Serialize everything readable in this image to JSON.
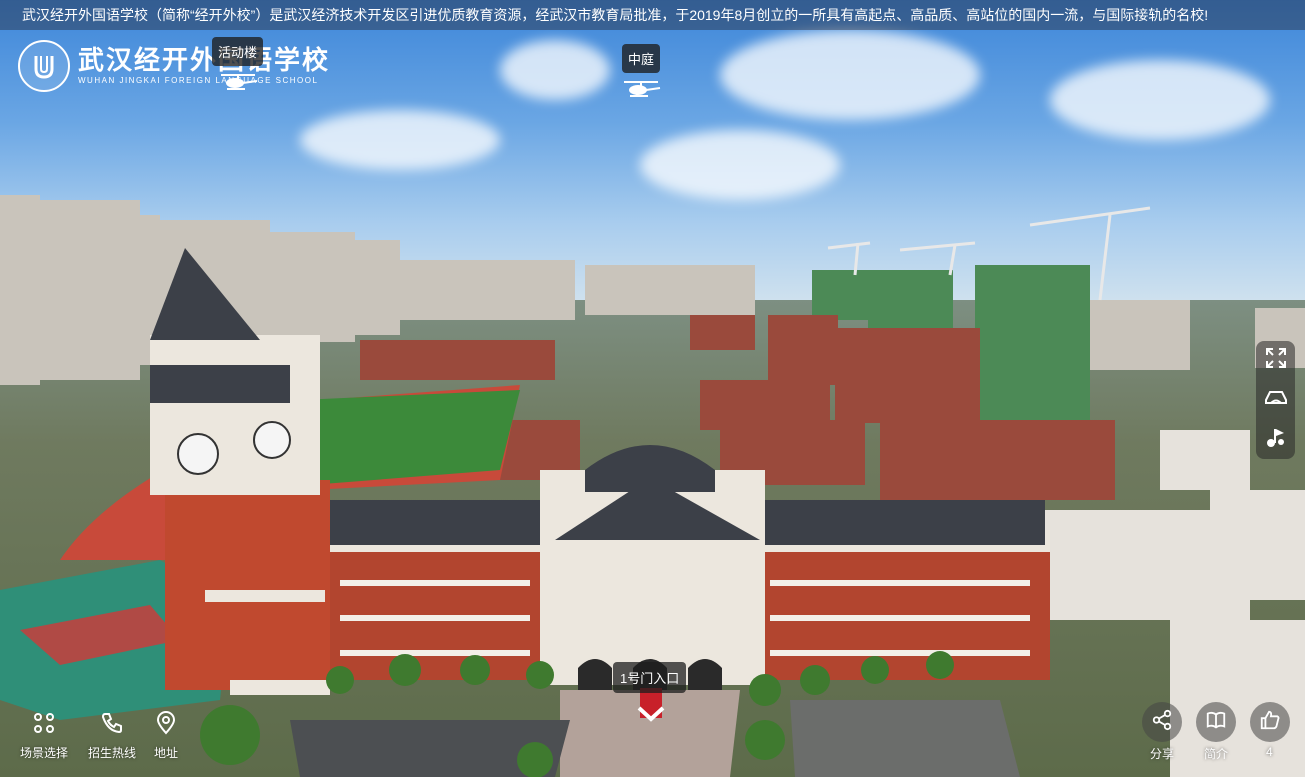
{
  "ticker": {
    "text": "武汉经开外国语学校（简称“经开外校”）是武汉经济技术开发区引进优质教育资源，经武汉市教育局批准，于2019年8月创立的一所具有高起点、高品质、高站位的国内一流，与国际接轨的名校!"
  },
  "logo": {
    "cn": "武汉经开外国语学校",
    "en": "WUHAN JINGKAI FOREIGN LANGUAGE SCHOOL"
  },
  "hotspots": {
    "courtyard": "中庭",
    "activity": "活动楼",
    "entrance": "1号门入口"
  },
  "bottom_nav": {
    "scene_select": "场景选择",
    "hotline": "招生热线",
    "address": "地址"
  },
  "bottom_right": {
    "share": "分享",
    "intro": "简介",
    "likes": "4"
  },
  "colors": {
    "brick": "#b2452f",
    "roof": "#3c4048",
    "field": "#3c8a3a",
    "track": "#c84a3a"
  }
}
